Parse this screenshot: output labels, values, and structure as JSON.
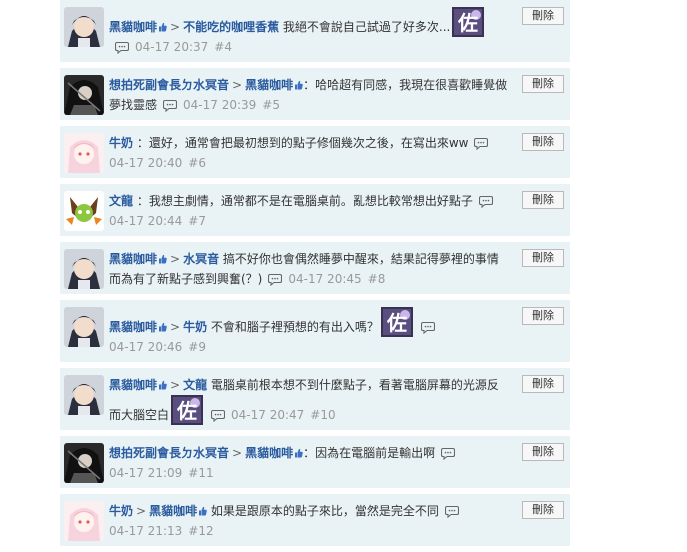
{
  "delete_label": "刪除",
  "colors": {
    "row_bg": "#e9f3f6",
    "username": "#2b5b9f",
    "meta": "#999999"
  },
  "comments": [
    {
      "avatar": "avatar-dark-hair-boy",
      "author": "黑貓咖啡",
      "reply_to": "不能吃的咖哩香蕉",
      "text": "我絕不會說自己試過了好多次...",
      "sticker": "佐",
      "time": "04-17 20:37",
      "floor": "#4"
    },
    {
      "avatar": "avatar-dark-cloak",
      "author": "想拍死副會長ㄉ水冥音",
      "reply_to": "黑貓咖啡",
      "text": "哈哈超有同感，我現在很喜歡睡覺做夢找靈感",
      "time": "04-17 20:39",
      "floor": "#5"
    },
    {
      "avatar": "avatar-pink-girl",
      "author": "牛奶",
      "reply_to": "",
      "text": "還好，通常會把最初想到的點子修個幾次之後，在寫出來ww",
      "time": "04-17 20:40",
      "floor": "#6"
    },
    {
      "avatar": "avatar-green-cat",
      "author": "文龍",
      "reply_to": "",
      "text": "我想主劇情，通常都不是在電腦桌前。亂想比較常想出好點子",
      "time": "04-17 20:44",
      "floor": "#7"
    },
    {
      "avatar": "avatar-dark-hair-boy",
      "author": "黑貓咖啡",
      "reply_to": "水冥音",
      "text": "搞不好你也會偶然睡夢中醒來，結果記得夢裡的事情而為有了新點子感到興奮(？)",
      "time": "04-17 20:45",
      "floor": "#8"
    },
    {
      "avatar": "avatar-dark-hair-boy",
      "author": "黑貓咖啡",
      "reply_to": "牛奶",
      "text": "不會和腦子裡預想的有出入嗎？",
      "sticker": "佐",
      "time": "04-17 20:46",
      "floor": "#9"
    },
    {
      "avatar": "avatar-dark-hair-boy",
      "author": "黑貓咖啡",
      "reply_to": "文龍",
      "text": "電腦桌前根本想不到什麼點子，看著電腦屏幕的光源反而大腦空白",
      "sticker": "佐",
      "time": "04-17 20:47",
      "floor": "#10"
    },
    {
      "avatar": "avatar-dark-cloak",
      "author": "想拍死副會長ㄉ水冥音",
      "reply_to": "黑貓咖啡",
      "text": "因為在電腦前是輸出啊",
      "time": "04-17 21:09",
      "floor": "#11"
    },
    {
      "avatar": "avatar-pink-girl",
      "author": "牛奶",
      "reply_to": "黑貓咖啡",
      "text": "如果是跟原本的點子來比，當然是完全不同",
      "time": "04-17 21:13",
      "floor": "#12"
    }
  ]
}
